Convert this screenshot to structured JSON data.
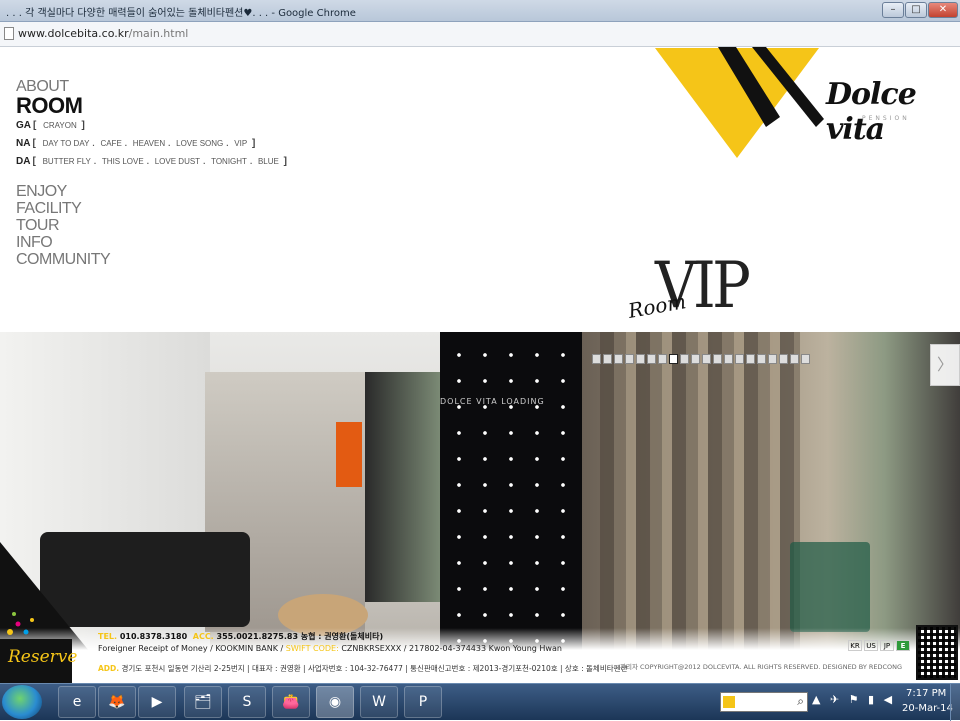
{
  "window": {
    "title": ". . . 각 객실마다 다양한 매력들이 숨어있는 돌체비타펜션♥. . .  - Google Chrome",
    "min_glyph": "–",
    "max_glyph": "□",
    "close_glyph": "✕"
  },
  "address": {
    "domain": "www.dolcebita.co.kr",
    "path": "/main.html"
  },
  "nav": {
    "about": "ABOUT",
    "room": "ROOM",
    "ga": {
      "label": "GA",
      "items": [
        "CRAYON"
      ]
    },
    "na": {
      "label": "NA",
      "items": [
        "DAY TO DAY",
        "CAFE",
        "HEAVEN",
        "LOVE SONG",
        "VIP"
      ]
    },
    "da": {
      "label": "DA",
      "items": [
        "BUTTER FLY",
        "THIS LOVE",
        "LOVE DUST",
        "TONIGHT",
        "BLUE"
      ]
    },
    "enjoy": "ENJOY",
    "facility": "FACILITY",
    "tour": "TOUR",
    "info": "INFO",
    "community": "COMMUNITY"
  },
  "logo": {
    "text": "Dolce vita",
    "sub": "PENSION"
  },
  "heading": {
    "vip": "VIP",
    "room": "Room"
  },
  "slideshow": {
    "loading": "DOLCE VITA LOADING",
    "next_glyph": "〉"
  },
  "footer": {
    "reserve": "Reserve",
    "tel_label": "TEL.",
    "tel": "010.8378.3180",
    "acc_label": "ACC.",
    "acc": "355.0021.8275.83 농협 : 권영환(돌체비타)",
    "foreign": "Foreigner Receipt of Money / KOOKMIN BANK /",
    "swift_label": "SWIFT CODE:",
    "swift": "CZNBKRSEXXX / 217802-04-374433 Kwon Young Hwan",
    "add_label": "ADD.",
    "add": "경기도 포천시 일동면 기산리 2-25번지 | 대표자 : 권영환 | 사업자번호 : 104-32-76477 | 통신판매신고번호 : 제2013-경기포천-0210호 | 상호 : 돌체비타펜션",
    "copyright": "관리자   COPYRIGHT@2012 DOLCEVITA. ALL RIGHTS RESERVED. DESIGNED BY REDCONG",
    "flags": [
      "KR",
      "US",
      "JP",
      "E"
    ]
  },
  "taskbar": {
    "apps": [
      "e",
      "🦊",
      "▶",
      "🗂",
      "S",
      "👛",
      "◉",
      "W",
      "P"
    ],
    "tray": "▲ ✈ ⚑ ▮ ◀",
    "time": "7:17 PM",
    "date": "20-Mar-14",
    "search_glyph": "⌕"
  },
  "colors": {
    "brand_yellow": "#f5c518",
    "text_dark": "#111111"
  }
}
